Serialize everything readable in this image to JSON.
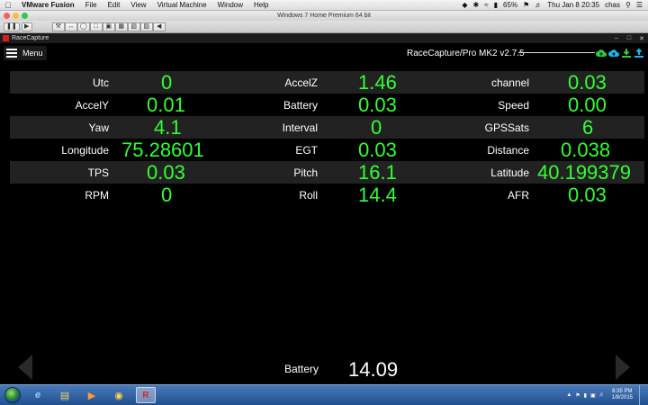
{
  "mac": {
    "app_name": "VMware Fusion",
    "menus": [
      "File",
      "Edit",
      "View",
      "Virtual Machine",
      "Window",
      "Help"
    ],
    "battery": "65%",
    "datetime": "Thu Jan 8  20:35",
    "user": "chas"
  },
  "vm": {
    "window_title": "Windows 7 Home Premium 64 bit"
  },
  "win_app": {
    "title": "RaceCapture"
  },
  "header": {
    "menu_label": "Menu",
    "version": "RaceCapture/Pro MK2 v2.7.5"
  },
  "channels": [
    [
      {
        "label": "Utc",
        "value": "0"
      },
      {
        "label": "AccelZ",
        "value": "1.46"
      },
      {
        "label": "channel",
        "value": "0.03"
      }
    ],
    [
      {
        "label": "AccelY",
        "value": "0.01"
      },
      {
        "label": "Battery",
        "value": "0.03"
      },
      {
        "label": "Speed",
        "value": "0.00"
      }
    ],
    [
      {
        "label": "Yaw",
        "value": "4.1"
      },
      {
        "label": "Interval",
        "value": "0"
      },
      {
        "label": "GPSSats",
        "value": "6"
      }
    ],
    [
      {
        "label": "Longitude",
        "value": "75.28601"
      },
      {
        "label": "EGT",
        "value": "0.03"
      },
      {
        "label": "Distance",
        "value": "0.038"
      }
    ],
    [
      {
        "label": "TPS",
        "value": "0.03"
      },
      {
        "label": "Pitch",
        "value": "16.1"
      },
      {
        "label": "Latitude",
        "value": "40.199379"
      }
    ],
    [
      {
        "label": "RPM",
        "value": "0"
      },
      {
        "label": "Roll",
        "value": "14.4"
      },
      {
        "label": "AFR",
        "value": "0.03"
      }
    ]
  ],
  "bottom": {
    "label": "Battery",
    "value": "14.09"
  },
  "taskbar": {
    "time": "8:35 PM",
    "date": "1/8/2015"
  },
  "colors": {
    "value_green": "#33ff33",
    "stripe": "#222222",
    "status_green": "#2ecc40",
    "status_cyan": "#1eb4e6"
  }
}
